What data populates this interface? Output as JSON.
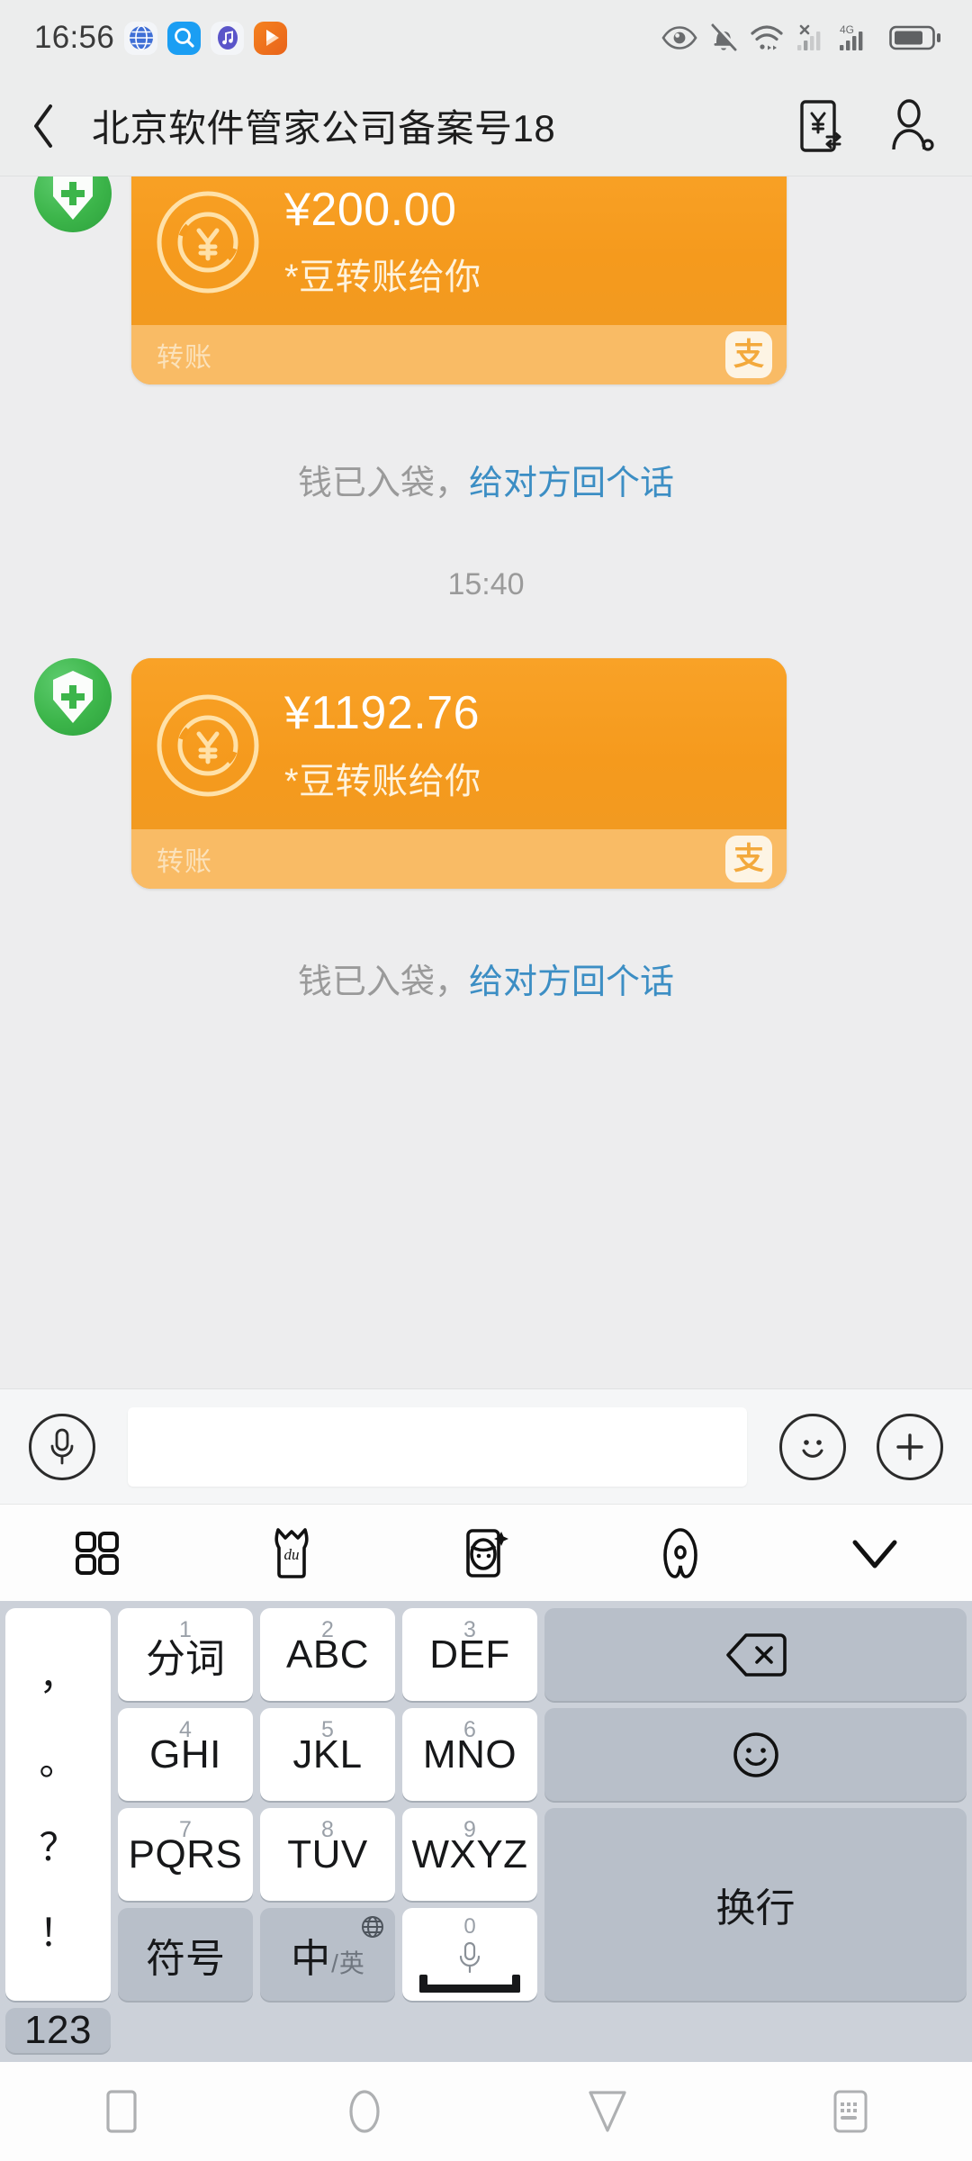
{
  "status_bar": {
    "time": "16:56",
    "left_icons": [
      "globe-app-icon",
      "search-app-icon",
      "music-app-icon",
      "video-app-icon"
    ],
    "right_icons": [
      "eye-icon",
      "bell-muted-icon",
      "wifi-icon",
      "signal-no-service-icon",
      "signal-4g-icon",
      "battery-icon"
    ],
    "network_label": "4G"
  },
  "header": {
    "back_icon": "chevron-left-icon",
    "title": "北京软件管家公司备案号18",
    "transfer_icon": "yuan-transfer-icon",
    "contact_icon": "contact-person-icon"
  },
  "chat": {
    "messages": [
      {
        "avatar": "green-shield-plus-avatar",
        "amount": "¥200.00",
        "desc": "*豆转账给你",
        "footer_label": "转账",
        "brand": "支",
        "hint_gray": "钱已入袋，",
        "hint_link": "给对方回个话"
      },
      {
        "avatar": "green-shield-plus-avatar",
        "amount": "¥1192.76",
        "desc": "*豆转账给你",
        "footer_label": "转账",
        "brand": "支",
        "hint_gray": "钱已入袋，",
        "hint_link": "给对方回个话"
      }
    ],
    "timestamp": "15:40"
  },
  "input_bar": {
    "voice_icon": "microphone-icon",
    "input_value": "",
    "input_placeholder": "",
    "emoji_icon": "smiley-icon",
    "more_icon": "plus-icon"
  },
  "keyboard": {
    "toolbar": [
      {
        "name": "keyboard-grid-icon"
      },
      {
        "name": "du-mascot-icon"
      },
      {
        "name": "sticker-face-icon"
      },
      {
        "name": "baidu-logo-icon"
      },
      {
        "name": "collapse-keyboard-icon"
      }
    ],
    "punct_key": {
      "chars": [
        "，",
        "。",
        "？",
        "！"
      ]
    },
    "keys": [
      {
        "sup": "1",
        "main": "分词",
        "style": "white"
      },
      {
        "sup": "2",
        "main": "ABC",
        "style": "white"
      },
      {
        "sup": "3",
        "main": "DEF",
        "style": "white"
      },
      {
        "sup": "4",
        "main": "GHI",
        "style": "white"
      },
      {
        "sup": "5",
        "main": "JKL",
        "style": "white"
      },
      {
        "sup": "6",
        "main": "MNO",
        "style": "white"
      },
      {
        "sup": "7",
        "main": "PQRS",
        "style": "white"
      },
      {
        "sup": "8",
        "main": "TUV",
        "style": "white"
      },
      {
        "sup": "9",
        "main": "WXYZ",
        "style": "white"
      }
    ],
    "backspace": {
      "icon": "backspace-icon"
    },
    "emoji_key": {
      "icon": "smiley-icon"
    },
    "enter_key": {
      "label": "换行"
    },
    "symbol_key": {
      "label": "符号"
    },
    "lang_key": {
      "primary": "中",
      "slash": "/",
      "secondary": "英",
      "globe": "globe-icon"
    },
    "space_key": {
      "sup": "0",
      "icon": "microphone-icon"
    },
    "num_key": {
      "label": "123"
    }
  },
  "nav_bar": {
    "buttons": [
      {
        "name": "recents-button",
        "icon": "square-icon"
      },
      {
        "name": "home-button",
        "icon": "circle-icon"
      },
      {
        "name": "back-button",
        "icon": "triangle-down-icon"
      },
      {
        "name": "hide-keyboard-button",
        "icon": "keyboard-icon"
      }
    ]
  },
  "colors": {
    "card_orange": "#f59a1d",
    "card_footer": "#f9bb65",
    "link_blue": "#3c8ec4",
    "avatar_green": "#3cb54a",
    "chat_bg": "#ededee",
    "keyboard_bg": "#ccd1d9"
  }
}
